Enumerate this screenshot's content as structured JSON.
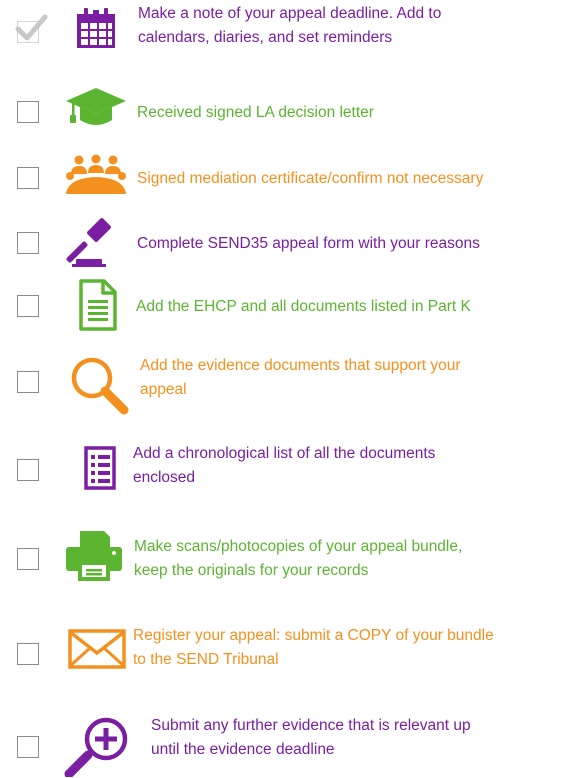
{
  "colors": {
    "purple": "#7a1fa2",
    "green": "#5cb531",
    "orange": "#f4911e",
    "checkbox_border": "#8c8c8c",
    "checkmark": "#c8c8c8"
  },
  "items": [
    {
      "checked": true,
      "icon": "calendar-icon",
      "color": "purple",
      "lines": [
        "Make a note of your appeal deadline. Add to",
        "calendars, diaries, and set reminders"
      ]
    },
    {
      "checked": false,
      "icon": "graduation-cap-icon",
      "color": "green",
      "lines": [
        "Received signed LA decision letter"
      ]
    },
    {
      "checked": false,
      "icon": "meeting-table-icon",
      "color": "orange",
      "lines": [
        "Signed mediation certificate/confirm not necessary"
      ]
    },
    {
      "checked": false,
      "icon": "gavel-icon",
      "color": "purple",
      "lines": [
        "Complete SEND35 appeal form with your reasons"
      ]
    },
    {
      "checked": false,
      "icon": "document-icon",
      "color": "green",
      "lines": [
        "Add the EHCP and all documents listed in Part K"
      ]
    },
    {
      "checked": false,
      "icon": "magnifying-glass-icon",
      "color": "orange",
      "lines": [
        "Add the evidence documents that support your",
        "appeal"
      ]
    },
    {
      "checked": false,
      "icon": "list-icon",
      "color": "purple",
      "lines": [
        "Add a chronological list of all the documents",
        "enclosed"
      ]
    },
    {
      "checked": false,
      "icon": "printer-icon",
      "color": "green",
      "lines": [
        "Make scans/photocopies of your appeal bundle,",
        "keep the originals for your records"
      ]
    },
    {
      "checked": false,
      "icon": "envelope-icon",
      "color": "orange",
      "lines": [
        "Register your appeal: submit a COPY of your bundle",
        "to the SEND Tribunal"
      ]
    },
    {
      "checked": false,
      "icon": "zoom-in-icon",
      "color": "purple",
      "lines": [
        "Submit any further evidence that is relevant up",
        "until the evidence deadline"
      ]
    }
  ]
}
